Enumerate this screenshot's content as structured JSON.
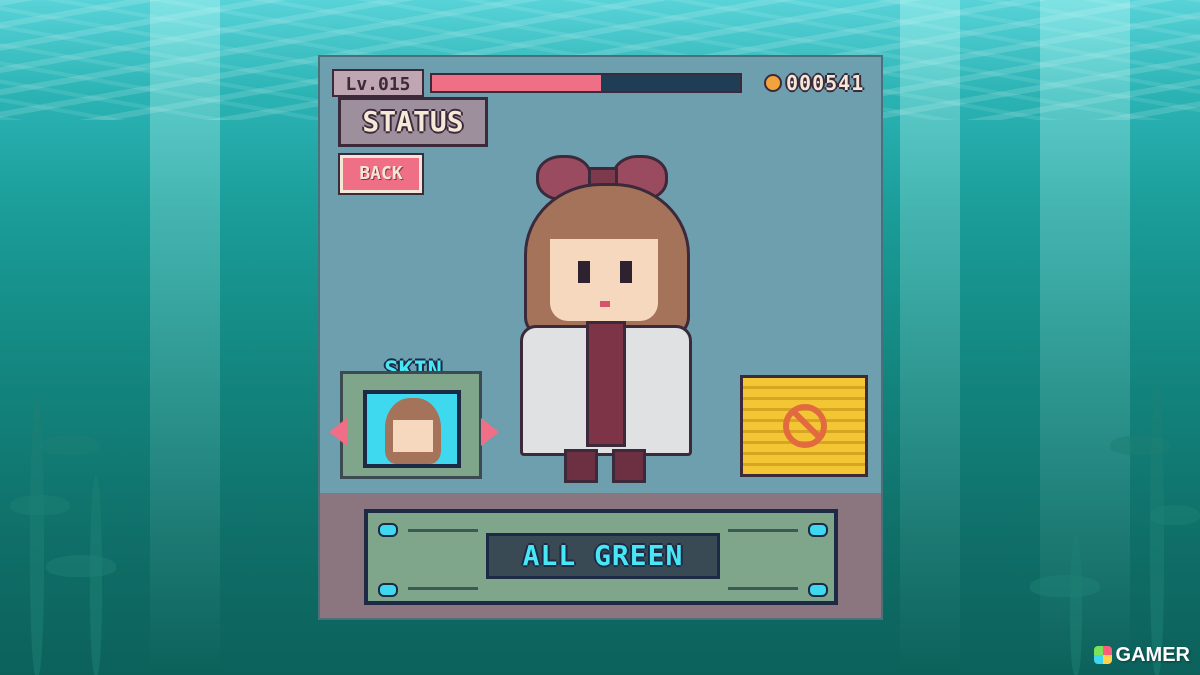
{
  "hud": {
    "level": "Lv.015",
    "hp_fraction": 0.55,
    "coins": "000541"
  },
  "status_tab": {
    "label": "STATUS"
  },
  "back_button": {
    "label": "BACK"
  },
  "skin_selector": {
    "label": "SKIN"
  },
  "status_board": {
    "text": "ALL GREEN"
  },
  "watermark": {
    "text": "GAMER"
  },
  "colors": {
    "hp_fill": "#ef6f86",
    "hp_track": "#1f3e55",
    "accent_cyan": "#47e7f3",
    "locked_yellow": "#f2c634"
  }
}
